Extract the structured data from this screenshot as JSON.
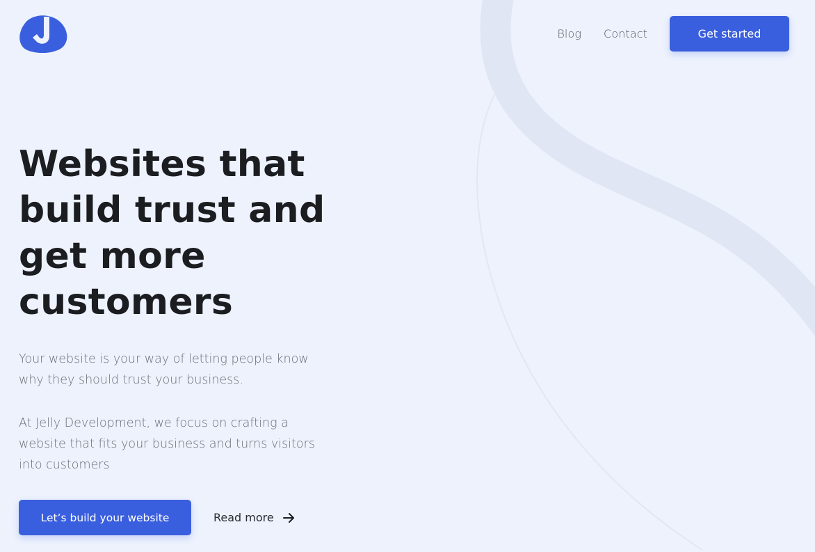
{
  "brand": {
    "logo_icon": "jelly-blob-logo-icon",
    "accent_color": "#3a5fde"
  },
  "nav": {
    "links": [
      {
        "label": "Blog"
      },
      {
        "label": "Contact"
      }
    ],
    "cta_label": "Get started"
  },
  "hero": {
    "title_lines": [
      "Websites that",
      "build trust and",
      "get more",
      "customers"
    ],
    "paragraph_1": "Your website is your way of letting people know why they should trust your business.",
    "paragraph_2": "At Jelly Development, we focus on crafting a website that fits your business and turns visitors into customers",
    "primary_cta_label": "Let’s build your website",
    "secondary_cta_label": "Read more",
    "secondary_cta_icon": "arrow-right-icon"
  },
  "colors": {
    "background": "#edf2fd",
    "heading": "#1b1d21",
    "body_text": "#6a6d73",
    "decor_stroke": "#dfe5f4"
  }
}
